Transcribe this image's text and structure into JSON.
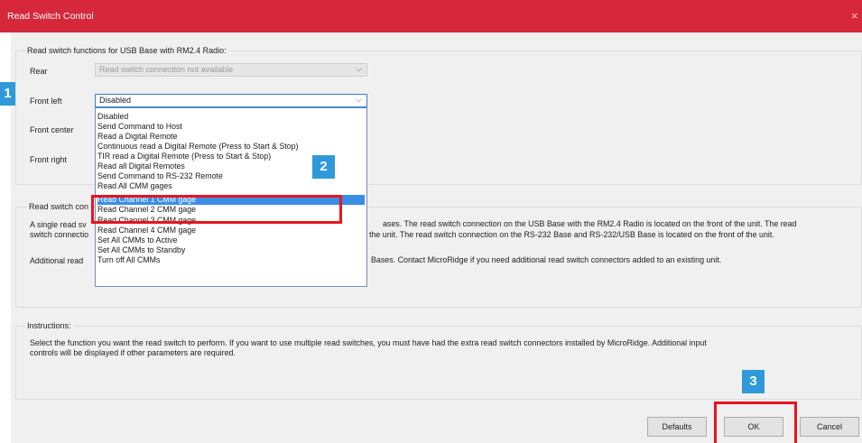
{
  "window": {
    "title": "Read Switch Control",
    "close_glyph": "×"
  },
  "functions_group": {
    "label": "Read switch functions for USB Base with RM2.4 Radio:",
    "rows": {
      "rear": {
        "label": "Rear",
        "value": "Read switch connection not available"
      },
      "front_left": {
        "label": "Front left",
        "value": "Disabled"
      },
      "front_center": {
        "label": "Front center"
      },
      "front_right": {
        "label": "Front right"
      }
    }
  },
  "dropdown": {
    "items": [
      "Disabled",
      "Send Command to Host",
      "Read a Digital Remote",
      "Continuous read a Digital Remote  (Press to Start & Stop)",
      "TIR read a Digital Remote  (Press to Start & Stop)",
      "Read all Digital Remotes",
      "Send Command to RS-232 Remote",
      "Read All CMM gages",
      "Read Channel 1 CMM gage",
      "Read Channel 2 CMM gage",
      "Read Channel 3 CMM gage",
      "Read Channel 4 CMM gage",
      "Set All CMMs to Active",
      "Set All CMMs to Standby",
      "Turn off All CMMs"
    ],
    "selected_index": 8
  },
  "connections_group": {
    "label": "Read switch con",
    "line1a": "A single read sv",
    "line1b": "ases.  The read switch connection on the USB Base with the RM2.4 Radio is located on the front of the unit.  The read",
    "line2a": "switch connectio",
    "line2b": "the unit.  The read switch connection on the RS-232 Base and RS-232/USB Base is located on the front of the unit.",
    "line3a": "Additional read",
    "line3b": "Bases.  Contact MicroRidge if you need additional read switch connectors added to an existing unit."
  },
  "instructions": {
    "label": "Instructions:",
    "line1": "Select the function you want the read switch to perform.  If you want to use multiple read switches, you must have had the extra read switch connectors installed by MicroRidge.  Additional input",
    "line2": "controls will be displayed if other parameters are required."
  },
  "buttons": {
    "defaults": "Defaults",
    "ok": "OK",
    "cancel": "Cancel"
  },
  "callouts": [
    "1",
    "2",
    "3"
  ],
  "colors": {
    "titlebar": "#d6283a",
    "callout": "#2f9ad9",
    "highlight": "#e8141e",
    "selection": "#3a8ee6"
  }
}
